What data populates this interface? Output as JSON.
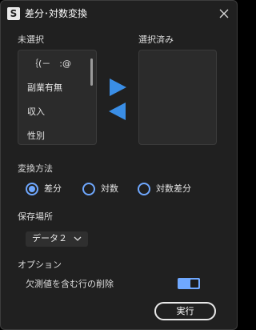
{
  "window": {
    "title": "差分･対数変換",
    "app_icon_letter": "S"
  },
  "lists": {
    "unselected_label": "未選択",
    "selected_label": "選択済み",
    "unselected_items": [
      "｛(－　:@",
      "副業有無",
      "収入",
      "性別"
    ],
    "selected_items": []
  },
  "transform": {
    "label": "変換方法",
    "options": [
      "差分",
      "対数",
      "対数差分"
    ],
    "selected": "差分"
  },
  "save": {
    "label": "保存場所",
    "value": "データ２"
  },
  "options": {
    "label": "オプション",
    "drop_missing_label": "欠測値を含む行の削除",
    "drop_missing_enabled": true
  },
  "run_label": "実行",
  "colors": {
    "accent": "#6fa8ff",
    "arrow": "#3a8ee6",
    "background": "#202020",
    "panel": "#2b2b2b"
  },
  "icons": {
    "app": "s-app-icon",
    "close": "close-icon",
    "move_right": "arrow-right-icon",
    "move_left": "arrow-left-icon",
    "dropdown": "chevron-down-icon"
  }
}
